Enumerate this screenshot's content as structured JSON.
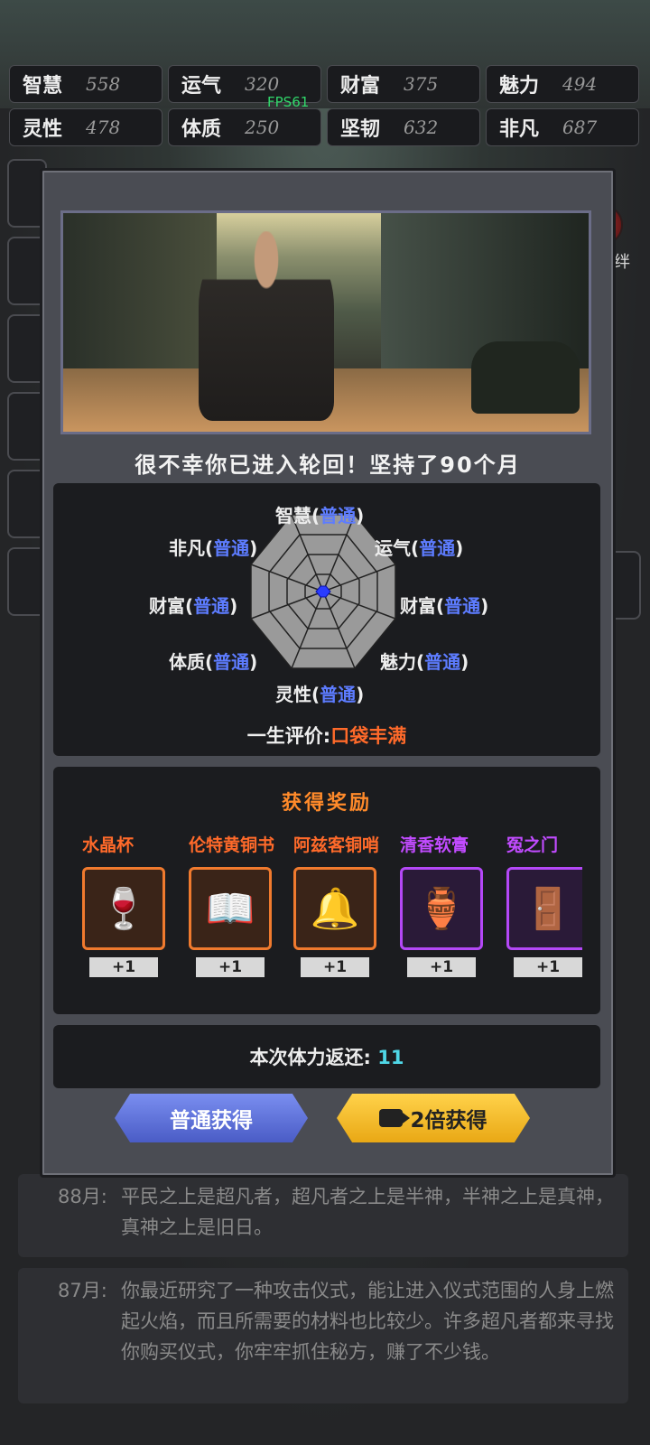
{
  "stats": [
    [
      {
        "name": "智慧",
        "value": "558"
      },
      {
        "name": "运气",
        "value": "320"
      },
      {
        "name": "财富",
        "value": "375"
      },
      {
        "name": "魅力",
        "value": "494"
      }
    ],
    [
      {
        "name": "灵性",
        "value": "478"
      },
      {
        "name": "体质",
        "value": "250"
      },
      {
        "name": "坚韧",
        "value": "632"
      },
      {
        "name": "非凡",
        "value": "687"
      }
    ]
  ],
  "fps": "FPS61",
  "side": {
    "bond_label": "羁绊"
  },
  "dialog": {
    "title": "很不幸你已进入轮回！坚持了90个月",
    "radar": {
      "labels": [
        {
          "name": "智慧",
          "grade": "普通"
        },
        {
          "name": "运气",
          "grade": "普通"
        },
        {
          "name": "财富",
          "grade": "普通"
        },
        {
          "name": "魅力",
          "grade": "普通"
        },
        {
          "name": "灵性",
          "grade": "普通"
        },
        {
          "name": "体质",
          "grade": "普通"
        },
        {
          "name": "财富",
          "grade": "普通"
        },
        {
          "name": "非凡",
          "grade": "普通"
        }
      ],
      "verdict_label": "一生评价:",
      "verdict_value": "口袋丰满"
    },
    "rewards_title": "获得奖励",
    "rewards": [
      {
        "name": "水晶杯",
        "count": "+1",
        "rarity": "orange",
        "icon": "goblet-icon",
        "glyph": "🍷"
      },
      {
        "name": "伦特黄铜书",
        "count": "+1",
        "rarity": "orange",
        "icon": "book-icon",
        "glyph": "📖"
      },
      {
        "name": "阿兹客铜哨",
        "count": "+1",
        "rarity": "orange",
        "icon": "whistle-icon",
        "glyph": "🔔"
      },
      {
        "name": "清香软膏",
        "count": "+1",
        "rarity": "purple",
        "icon": "ointment-jar-icon",
        "glyph": "🏺"
      },
      {
        "name": "冤之门",
        "count": "+1",
        "rarity": "purple",
        "icon": "door-icon",
        "glyph": "🚪"
      }
    ],
    "stamina_label": "本次体力返还:",
    "stamina_value": "11",
    "btn_normal": "普通获得",
    "btn_double": "2倍获得"
  },
  "logs": [
    {
      "month": "88月:",
      "text": "平民之上是超凡者，超凡者之上是半神，半神之上是真神，真神之上是旧日。"
    },
    {
      "month": "87月:",
      "text": "你最近研究了一种攻击仪式，能让进入仪式范围的人身上燃起火焰，而且所需要的材料也比较少。许多超凡者都来寻找你购买仪式，你牢牢抓住秘方，赚了不少钱。"
    }
  ],
  "colors": {
    "grade": "#5d7cff",
    "orange": "#ff6a2a",
    "purple": "#c14bff",
    "stamina": "#4fd6e6"
  }
}
